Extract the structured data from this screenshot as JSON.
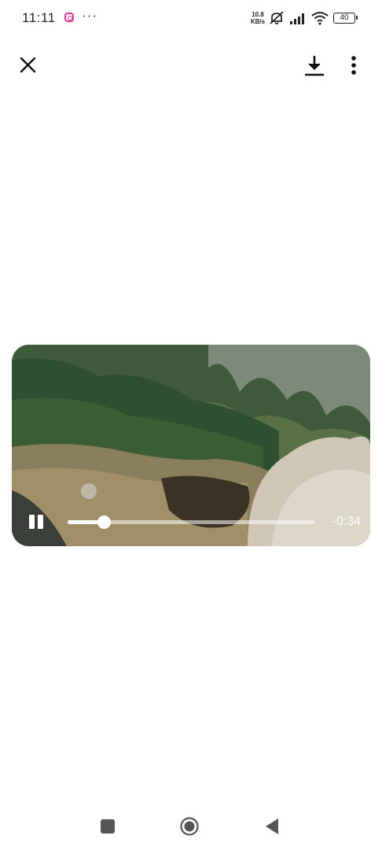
{
  "status_bar": {
    "time": "11:11",
    "notification_more": "···",
    "network_speed_value": "10.8",
    "network_speed_unit": "KB/s",
    "battery_level": "40",
    "icons": [
      "instagram-icon",
      "mute-icon",
      "signal-icon",
      "wifi-icon",
      "battery-icon"
    ]
  },
  "top_bar": {
    "icons": [
      "close-icon",
      "download-icon",
      "more-vertical-icon"
    ]
  },
  "video": {
    "remaining_time": "-0:34",
    "progress": 0.145,
    "state": "playing",
    "icons": [
      "pause-icon"
    ]
  },
  "nav_bar": {
    "icons": [
      "recent-apps-icon",
      "home-icon",
      "back-icon"
    ]
  },
  "colors": {
    "background": "#ffffff",
    "icon": "#111111",
    "control": "#ffffff"
  }
}
